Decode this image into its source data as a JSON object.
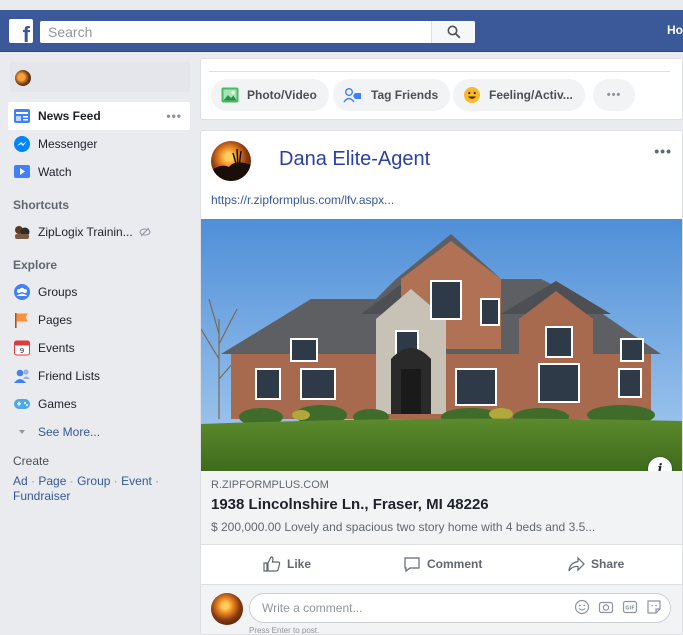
{
  "header": {
    "logo_letter": "f",
    "search_placeholder": "Search",
    "home_label": "Ho"
  },
  "sidebar": {
    "items": [
      {
        "label": "News Feed",
        "icon": "news-feed-icon",
        "more": "•••"
      },
      {
        "label": "Messenger",
        "icon": "messenger-icon"
      },
      {
        "label": "Watch",
        "icon": "watch-icon"
      }
    ],
    "shortcuts_heading": "Shortcuts",
    "shortcuts": [
      {
        "label": "ZipLogix Trainin...",
        "icon": "ziplogix-group-icon"
      }
    ],
    "explore_heading": "Explore",
    "explore": [
      {
        "label": "Groups",
        "icon": "groups-icon"
      },
      {
        "label": "Pages",
        "icon": "pages-flag-icon"
      },
      {
        "label": "Events",
        "icon": "events-calendar-icon"
      },
      {
        "label": "Friend Lists",
        "icon": "friend-lists-icon"
      },
      {
        "label": "Games",
        "icon": "games-controller-icon"
      },
      {
        "label": "See More...",
        "icon": "chevron-down-icon"
      }
    ],
    "create_heading": "Create",
    "create_links": [
      "Ad",
      "Page",
      "Group",
      "Event",
      "Fundraiser"
    ]
  },
  "composer": {
    "buttons": [
      {
        "label": "Photo/Video",
        "icon": "photo-video-icon"
      },
      {
        "label": "Tag Friends",
        "icon": "tag-friends-icon"
      },
      {
        "label": "Feeling/Activ...",
        "icon": "feeling-emoji-icon"
      },
      {
        "label": "•••",
        "icon": "more-icon"
      }
    ]
  },
  "post": {
    "author": "Dana Elite-Agent",
    "options": "•••",
    "link_url": "https://r.zipformplus.com/lfv.aspx...",
    "domain": "R.ZIPFORMPLUS.COM",
    "title": "1938 Lincolnshire Ln., Fraser, MI 48226",
    "description": "$ 200,000.00  Lovely and spacious two story home with 4 beds and 3.5...",
    "info": "i",
    "actions": {
      "like": "Like",
      "comment": "Comment",
      "share": "Share"
    },
    "comment_placeholder": "Write a comment...",
    "press_enter": "Press Enter to post."
  },
  "colors": {
    "topbar": "#3b5998",
    "link": "#365899",
    "author": "#2b3fa8"
  }
}
